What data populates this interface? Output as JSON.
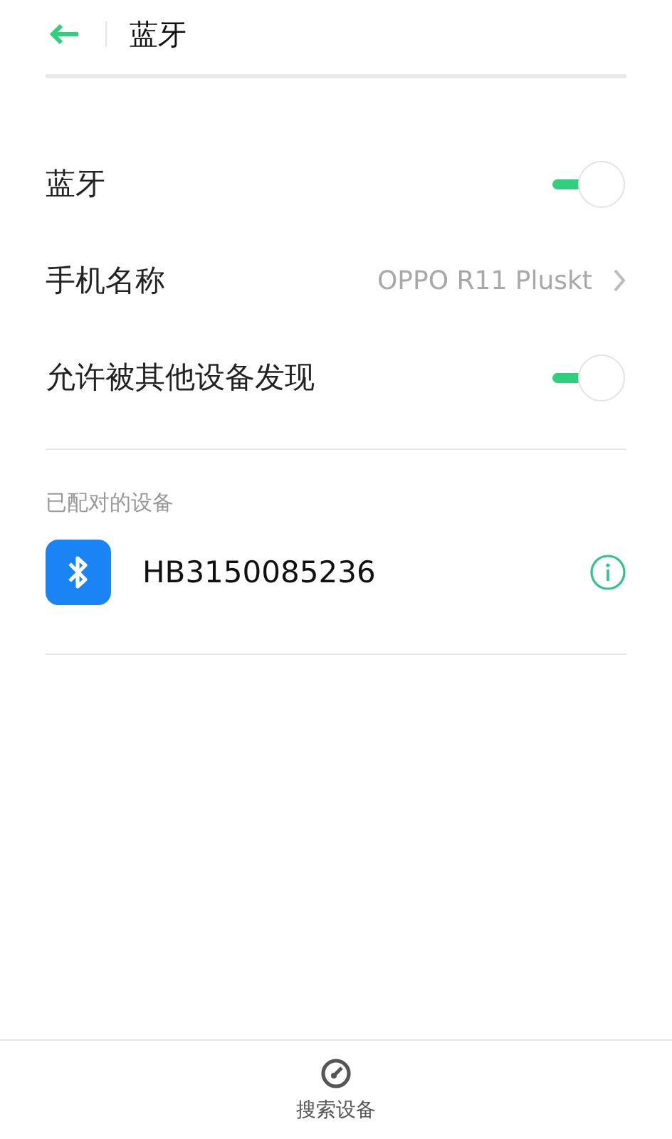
{
  "header": {
    "title": "蓝牙"
  },
  "settings": [
    {
      "kind": "toggle",
      "label": "蓝牙",
      "on": true
    },
    {
      "kind": "value",
      "label": "手机名称",
      "value": "OPPO R11 Pluskt"
    },
    {
      "kind": "toggle",
      "label": "允许被其他设备发现",
      "on": true
    }
  ],
  "paired_section": {
    "heading": "已配对的设备",
    "devices": [
      {
        "name": "HB3150085236"
      }
    ]
  },
  "bottom_bar": {
    "label": "搜索设备"
  }
}
